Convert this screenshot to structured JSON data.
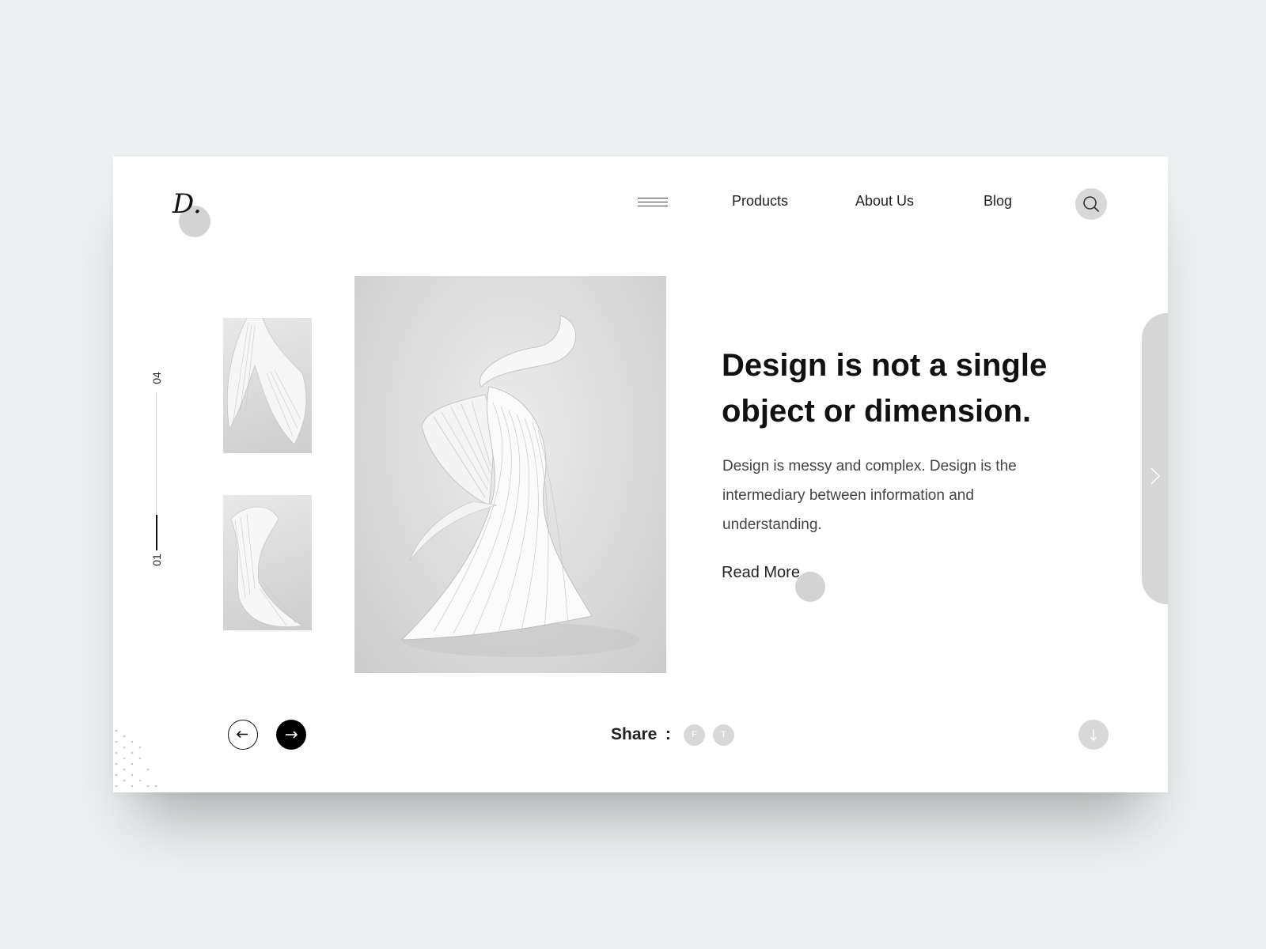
{
  "header": {
    "logo_text": "D.",
    "menu_icon": "hamburger-menu-icon",
    "nav": [
      {
        "label": "Products"
      },
      {
        "label": "About Us"
      },
      {
        "label": "Blog"
      }
    ],
    "search_icon": "search-icon"
  },
  "pager": {
    "current": "01",
    "total": "04",
    "progress": 0.25
  },
  "gallery": {
    "thumbnails": [
      "paper-sculpture-thumbnail-1",
      "paper-sculpture-thumbnail-2"
    ],
    "hero": "paper-sculpture-hero-image"
  },
  "content": {
    "headline_line1": "Design is not a single",
    "headline_line2": "object or dimension.",
    "description_line1": "Design is messy and complex. Design is the",
    "description_line2": "intermediary between information and",
    "description_line3": "understanding.",
    "read_more": "Read More"
  },
  "side_tab": {
    "icon": "chevron-right-icon"
  },
  "footer": {
    "prev_icon": "arrow-left-icon",
    "next_icon": "arrow-right-icon",
    "share_label": "Share",
    "share_separator": ":",
    "social": [
      {
        "label": "F",
        "icon": "facebook-icon"
      },
      {
        "label": "T",
        "icon": "twitter-icon"
      }
    ],
    "scroll_icon": "arrow-down-icon"
  },
  "colors": {
    "page_bg": "#edf0f1",
    "card_bg": "#ffffff",
    "text": "#111111",
    "muted": "#444444",
    "accent_gray": "#d6d6d6",
    "dark_button": "#000000"
  }
}
